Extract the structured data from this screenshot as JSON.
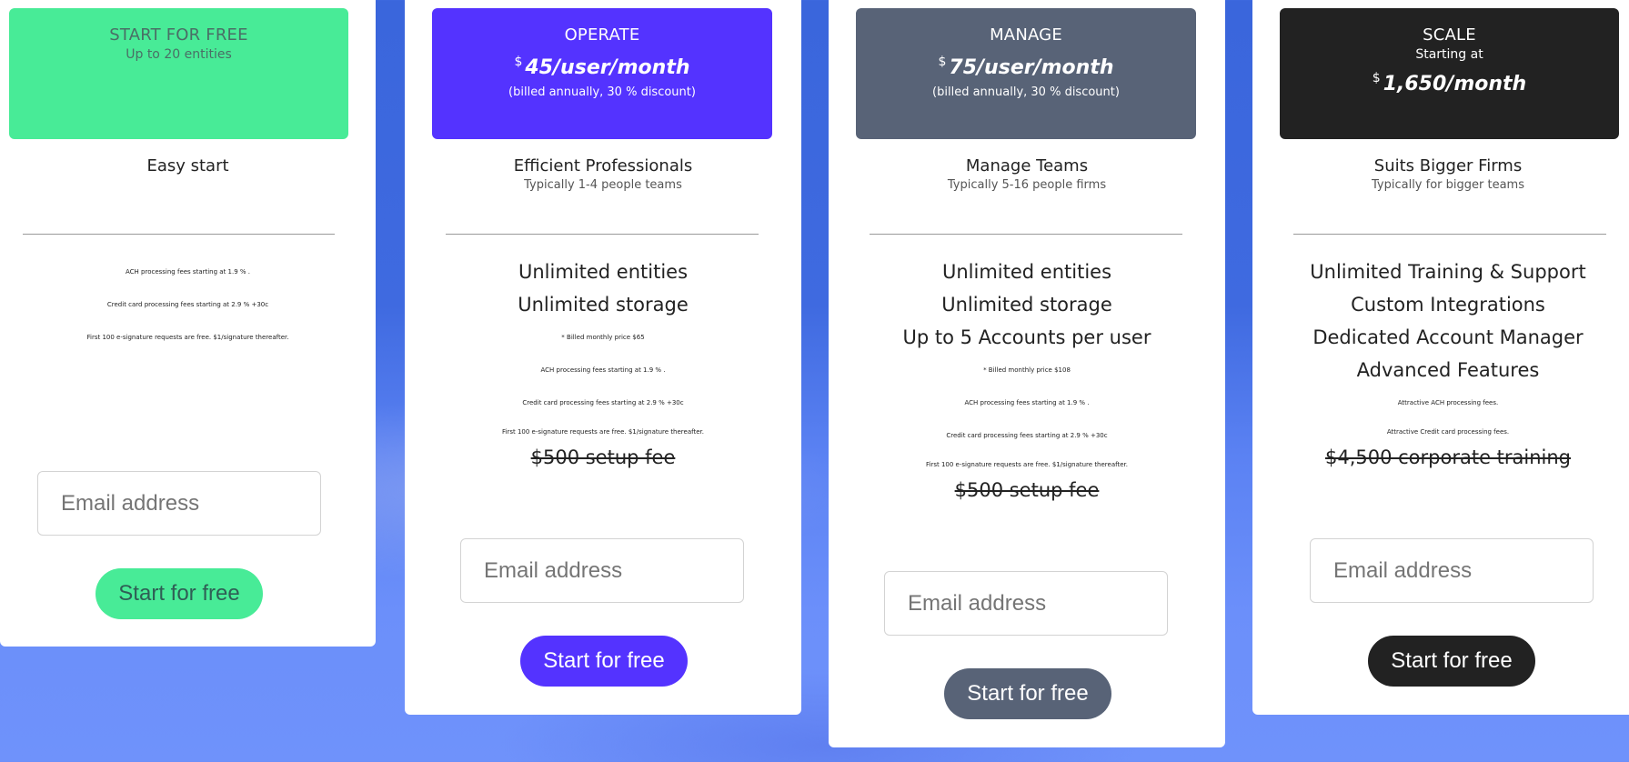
{
  "plans": [
    {
      "name": "START FOR FREE",
      "subtitle": "Up to 20 entities",
      "tagline": "Easy start",
      "tagline_sub": "",
      "header_color": "#48eb97",
      "header_text_color": "#4a6e66",
      "features_big": [],
      "features_small": [
        "ACH processing fees starting at 1.9 % .",
        "Credit card processing fees starting at 2.9 % +30c",
        "First 100 e-signature requests are free. $1/signature thereafter."
      ],
      "strike": "",
      "email_placeholder": "Email address",
      "cta_label": "Start for free",
      "cta_color": "#48eb97",
      "cta_text_color": "#2f5e55"
    },
    {
      "name": "OPERATE",
      "currency": "$",
      "price": "45/user/month",
      "billed": "(billed annually, 30 %  discount)",
      "tagline": "Efficient Professionals",
      "tagline_sub": "Typically 1-4 people teams",
      "header_color": "#5433ff",
      "header_text_color": "#ffffff",
      "features_big": [
        "Unlimited entities",
        "Unlimited storage"
      ],
      "features_small": [
        "* Billed monthly price $65",
        "ACH processing fees starting at 1.9 % .",
        "Credit card processing fees starting at 2.9 % +30c",
        "First 100 e-signature requests are free. $1/signature thereafter."
      ],
      "strike": "$500 setup fee",
      "email_placeholder": "Email address",
      "cta_label": "Start for free",
      "cta_color": "#5433ff",
      "cta_text_color": "#ffffff"
    },
    {
      "name": "MANAGE",
      "currency": "$",
      "price": "75/user/month",
      "billed": "(billed annually, 30 %  discount)",
      "tagline": "Manage Teams",
      "tagline_sub": "Typically 5-16 people firms",
      "header_color": "#586377",
      "header_text_color": "#ffffff",
      "features_big": [
        "Unlimited entities",
        "Unlimited storage",
        "Up to 5 Accounts per user"
      ],
      "features_small": [
        "* Billed monthly price $108",
        "ACH processing fees starting at 1.9 % .",
        "Credit card processing fees starting at 2.9 % +30c",
        "First 100 e-signature requests are free. $1/signature thereafter."
      ],
      "strike": "$500 setup fee",
      "email_placeholder": "Email address",
      "cta_label": "Start for free",
      "cta_color": "#586377",
      "cta_text_color": "#ffffff"
    },
    {
      "name": "SCALE",
      "subtitle": "Starting at",
      "currency": "$",
      "price": "1,650/month",
      "tagline": "Suits Bigger Firms",
      "tagline_sub": "Typically for bigger teams",
      "header_color": "#222222",
      "header_text_color": "#ffffff",
      "features_big": [
        "Unlimited Training & Support",
        "Custom Integrations",
        "Dedicated Account Manager",
        "Advanced Features"
      ],
      "features_small": [
        "Attractive ACH processing fees.",
        "Attractive Credit card processing fees."
      ],
      "strike": "$4,500 corporate training",
      "email_placeholder": "Email address",
      "cta_label": "Start for free",
      "cta_color": "#222222",
      "cta_text_color": "#ffffff"
    }
  ]
}
